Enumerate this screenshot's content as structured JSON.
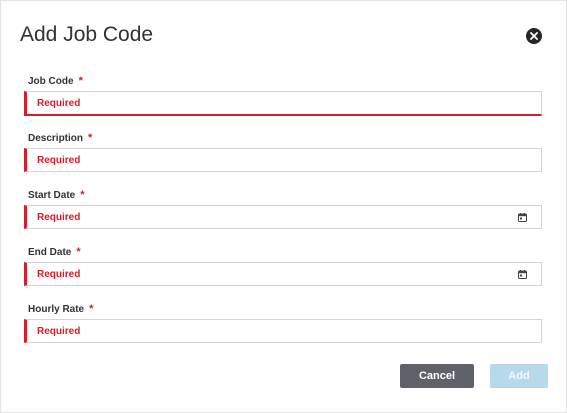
{
  "dialog": {
    "title": "Add Job Code",
    "close_icon": "close-circle-icon"
  },
  "fields": [
    {
      "label": "Job Code",
      "required_mark": "*",
      "placeholder": "Required",
      "icon": null
    },
    {
      "label": "Description",
      "required_mark": "*",
      "placeholder": "Required",
      "icon": null
    },
    {
      "label": "Start Date",
      "required_mark": "*",
      "placeholder": "Required",
      "icon": "calendar-icon"
    },
    {
      "label": "End Date",
      "required_mark": "*",
      "placeholder": "Required",
      "icon": "calendar-icon"
    },
    {
      "label": "Hourly Rate",
      "required_mark": "*",
      "placeholder": "Required",
      "icon": null
    }
  ],
  "buttons": {
    "cancel_label": "Cancel",
    "add_label": "Add"
  },
  "colors": {
    "error": "#d0202e",
    "cancel_bg": "#5f6268",
    "add_bg_disabled": "#b8d8eb"
  }
}
